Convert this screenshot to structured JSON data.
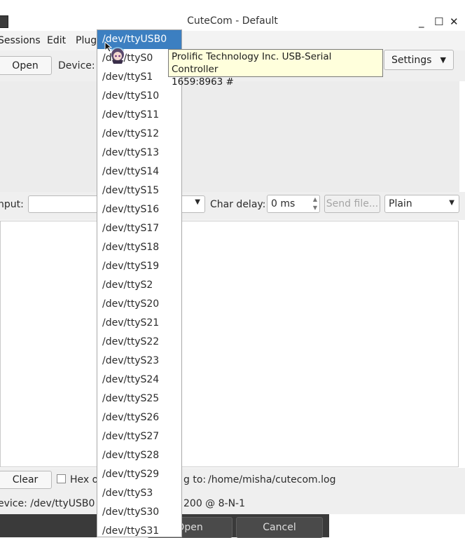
{
  "window": {
    "title": "CuteCom - Default",
    "minimize": "_",
    "maximize": "☐",
    "close": "✕"
  },
  "menu": {
    "sessions": "Sessions",
    "edit": "Edit",
    "plugins": "Plug"
  },
  "toolbar": {
    "open": "Open",
    "device_label": "Device:",
    "settings": "Settings"
  },
  "inputrow": {
    "input_label": "nput:",
    "char_delay_label": "Char delay:",
    "char_delay_value": "0 ms",
    "send_file": "Send file...",
    "mode": "Plain"
  },
  "bottomrow": {
    "clear": "Clear",
    "hex_label": "Hex o",
    "log_to_label": "g to:",
    "log_path": "/home/misha/cutecom.log"
  },
  "status": {
    "device": "evice:  /dev/ttyUSB0",
    "settings": "200 @ 8-N-1"
  },
  "dialog": {
    "open": "Open",
    "cancel": "Cancel"
  },
  "tooltip": {
    "line1": "Prolific Technology Inc. USB-Serial Controller",
    "line2": "1659:8963 #"
  },
  "device_list": [
    "/dev/ttyUSB0",
    "/dev/ttyS0",
    "/dev/ttyS1",
    "/dev/ttyS10",
    "/dev/ttyS11",
    "/dev/ttyS12",
    "/dev/ttyS13",
    "/dev/ttyS14",
    "/dev/ttyS15",
    "/dev/ttyS16",
    "/dev/ttyS17",
    "/dev/ttyS18",
    "/dev/ttyS19",
    "/dev/ttyS2",
    "/dev/ttyS20",
    "/dev/ttyS21",
    "/dev/ttyS22",
    "/dev/ttyS23",
    "/dev/ttyS24",
    "/dev/ttyS25",
    "/dev/ttyS26",
    "/dev/ttyS27",
    "/dev/ttyS28",
    "/dev/ttyS29",
    "/dev/ttyS3",
    "/dev/ttyS30",
    "/dev/ttyS31"
  ],
  "selected_index": 0
}
